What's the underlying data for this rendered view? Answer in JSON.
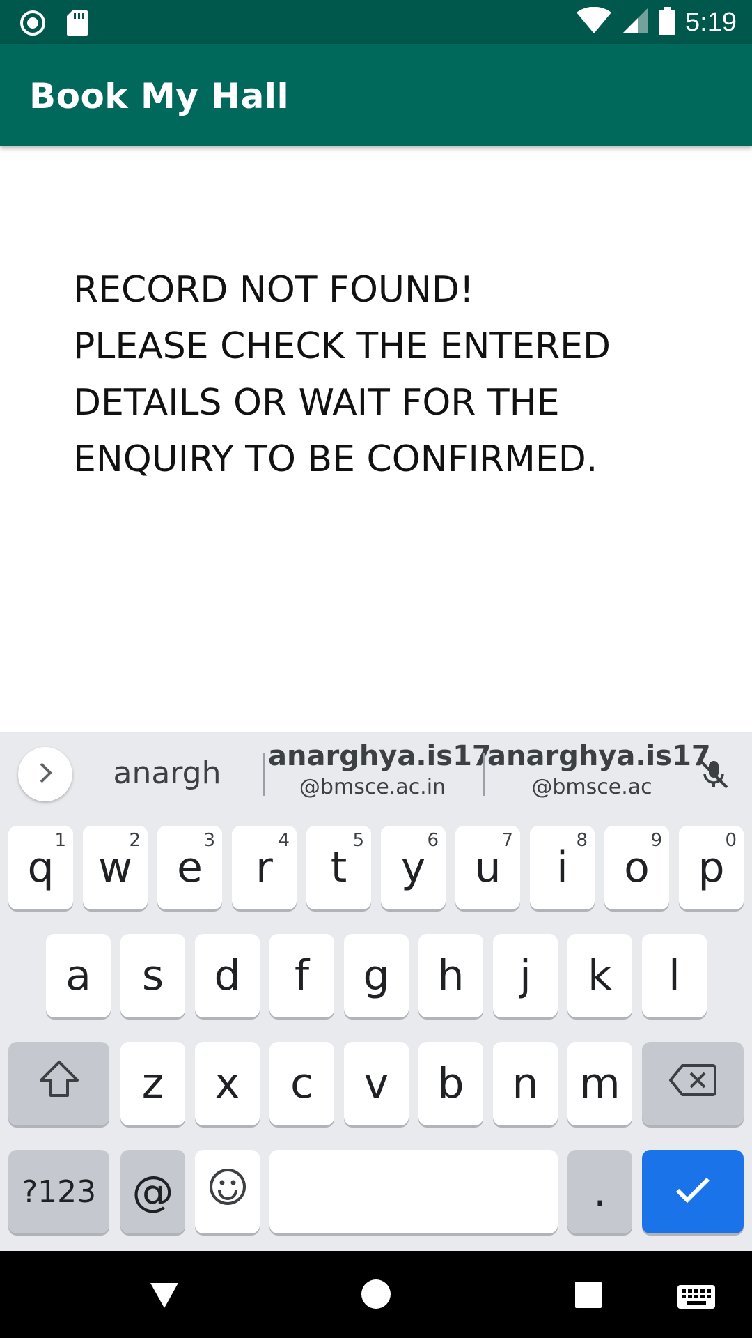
{
  "status_bar": {
    "time": "5:19",
    "left_icons": [
      "radio-button-icon",
      "sd-card-icon"
    ],
    "right_icons": [
      "wifi-icon",
      "signal-icon",
      "battery-icon"
    ]
  },
  "app_bar": {
    "title": "Book My Hall"
  },
  "message": {
    "lines": [
      "RECORD NOT FOUND!",
      "PLEASE CHECK THE ENTERED",
      "DETAILS OR WAIT FOR THE",
      "ENQUIRY TO BE CONFIRMED."
    ]
  },
  "keyboard": {
    "suggestions": [
      {
        "main": "anargh",
        "sub": ""
      },
      {
        "main": "anarghya.is17",
        "sub": "@bmsce.ac.in"
      },
      {
        "main": "anarghya.is17",
        "sub": "@bmsce.ac"
      }
    ],
    "row1": [
      {
        "k": "q",
        "h": "1"
      },
      {
        "k": "w",
        "h": "2"
      },
      {
        "k": "e",
        "h": "3"
      },
      {
        "k": "r",
        "h": "4"
      },
      {
        "k": "t",
        "h": "5"
      },
      {
        "k": "y",
        "h": "6"
      },
      {
        "k": "u",
        "h": "7"
      },
      {
        "k": "i",
        "h": "8"
      },
      {
        "k": "o",
        "h": "9"
      },
      {
        "k": "p",
        "h": "0"
      }
    ],
    "row2": [
      "a",
      "s",
      "d",
      "f",
      "g",
      "h",
      "j",
      "k",
      "l"
    ],
    "row3": [
      "z",
      "x",
      "c",
      "v",
      "b",
      "n",
      "m"
    ],
    "symbols_label": "?123",
    "at_label": "@",
    "period_label": "."
  },
  "colors": {
    "status_bar": "#00574b",
    "app_bar": "#00695c",
    "enter_key": "#1a73e8",
    "keyboard_bg": "#e8eaed"
  }
}
